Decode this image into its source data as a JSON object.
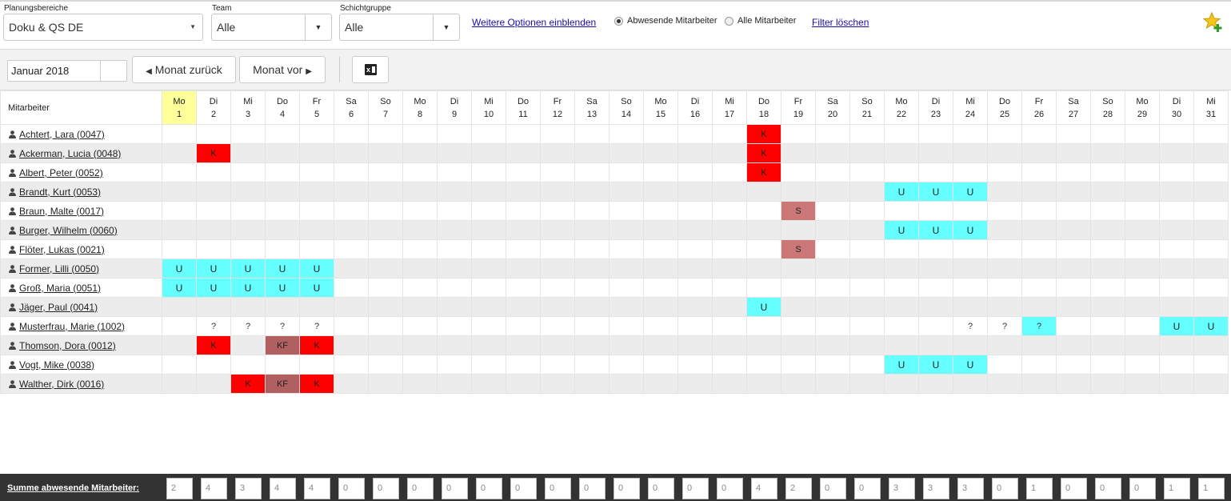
{
  "filters": {
    "planning": {
      "label": "Planungsbereiche",
      "value": "Doku & QS DE"
    },
    "team": {
      "label": "Team",
      "value": "Alle"
    },
    "shift": {
      "label": "Schichtgruppe",
      "value": "Alle"
    },
    "more_options": "Weitere Optionen einblenden",
    "radio_absent": "Abwesende Mitarbeiter",
    "radio_all": "Alle Mitarbeiter",
    "radio_selected": "absent",
    "clear": "Filter löschen"
  },
  "toolbar": {
    "month": "Januar 2018",
    "prev": "Monat zurück",
    "next": "Monat vor",
    "excel_icon": "excel-export-icon"
  },
  "grid": {
    "employee_header": "Mitarbeiter",
    "today_index": 0,
    "days": [
      {
        "wd": "Mo",
        "d": "1"
      },
      {
        "wd": "Di",
        "d": "2"
      },
      {
        "wd": "Mi",
        "d": "3"
      },
      {
        "wd": "Do",
        "d": "4"
      },
      {
        "wd": "Fr",
        "d": "5"
      },
      {
        "wd": "Sa",
        "d": "6"
      },
      {
        "wd": "So",
        "d": "7"
      },
      {
        "wd": "Mo",
        "d": "8"
      },
      {
        "wd": "Di",
        "d": "9"
      },
      {
        "wd": "Mi",
        "d": "10"
      },
      {
        "wd": "Do",
        "d": "11"
      },
      {
        "wd": "Fr",
        "d": "12"
      },
      {
        "wd": "Sa",
        "d": "13"
      },
      {
        "wd": "So",
        "d": "14"
      },
      {
        "wd": "Mo",
        "d": "15"
      },
      {
        "wd": "Di",
        "d": "16"
      },
      {
        "wd": "Mi",
        "d": "17"
      },
      {
        "wd": "Do",
        "d": "18"
      },
      {
        "wd": "Fr",
        "d": "19"
      },
      {
        "wd": "Sa",
        "d": "20"
      },
      {
        "wd": "So",
        "d": "21"
      },
      {
        "wd": "Mo",
        "d": "22"
      },
      {
        "wd": "Di",
        "d": "23"
      },
      {
        "wd": "Mi",
        "d": "24"
      },
      {
        "wd": "Do",
        "d": "25"
      },
      {
        "wd": "Fr",
        "d": "26"
      },
      {
        "wd": "Sa",
        "d": "27"
      },
      {
        "wd": "So",
        "d": "28"
      },
      {
        "wd": "Mo",
        "d": "29"
      },
      {
        "wd": "Di",
        "d": "30"
      },
      {
        "wd": "Mi",
        "d": "31"
      }
    ],
    "employees": [
      {
        "name": "Achtert, Lara (0047)",
        "cells": {
          "18": "K"
        }
      },
      {
        "name": "Ackerman, Lucia (0048)",
        "cells": {
          "2": "K",
          "18": "K"
        }
      },
      {
        "name": "Albert, Peter (0052)",
        "cells": {
          "18": "K"
        }
      },
      {
        "name": "Brandt, Kurt (0053)",
        "cells": {
          "22": "U",
          "23": "U",
          "24": "U"
        }
      },
      {
        "name": "Braun, Malte (0017)",
        "cells": {
          "19": "S"
        }
      },
      {
        "name": "Burger, Wilhelm (0060)",
        "cells": {
          "22": "U",
          "23": "U",
          "24": "U"
        }
      },
      {
        "name": "Flöter, Lukas (0021)",
        "cells": {
          "19": "S"
        }
      },
      {
        "name": "Former, Lilli (0050)",
        "cells": {
          "1": "U",
          "2": "U",
          "3": "U",
          "4": "U",
          "5": "U"
        }
      },
      {
        "name": "Groß, Maria (0051)",
        "cells": {
          "1": "U",
          "2": "U",
          "3": "U",
          "4": "U",
          "5": "U"
        }
      },
      {
        "name": "Jäger, Paul (0041)",
        "cells": {
          "18": "U"
        }
      },
      {
        "name": "Musterfrau, Marie (1002)",
        "cells": {
          "2": "?",
          "3": "?",
          "4": "?",
          "5": "?",
          "24": "?",
          "25": "?",
          "26": "?U",
          "30": "U",
          "31": "U"
        }
      },
      {
        "name": "Thomson, Dora (0012)",
        "cells": {
          "2": "K",
          "4": "KF",
          "5": "K"
        }
      },
      {
        "name": "Vogt, Mike (0038)",
        "cells": {
          "22": "U",
          "23": "U",
          "24": "U"
        }
      },
      {
        "name": "Walther, Dirk (0016)",
        "cells": {
          "3": "K",
          "4": "KF",
          "5": "K"
        }
      }
    ]
  },
  "footer": {
    "label": "Summe abwesende Mitarbeiter:",
    "sums": [
      "2",
      "4",
      "3",
      "4",
      "4",
      "0",
      "0",
      "0",
      "0",
      "0",
      "0",
      "0",
      "0",
      "0",
      "0",
      "0",
      "0",
      "4",
      "2",
      "0",
      "0",
      "3",
      "3",
      "3",
      "0",
      "1",
      "0",
      "0",
      "0",
      "1",
      "1"
    ]
  }
}
